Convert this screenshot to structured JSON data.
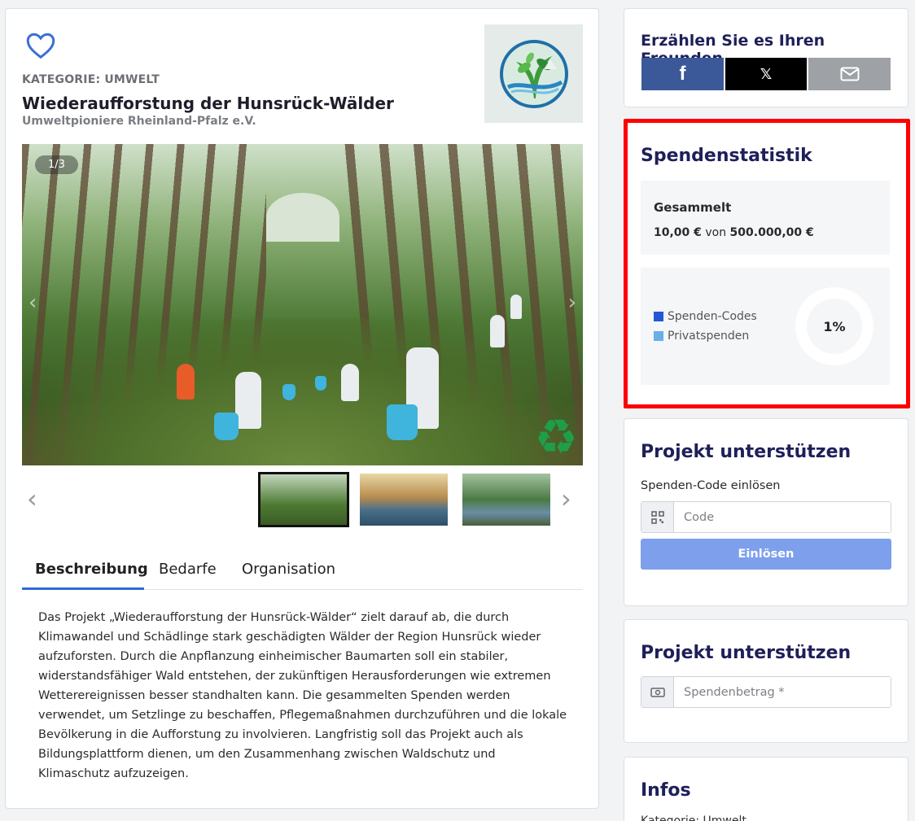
{
  "project": {
    "category": "KATEGORIE: UMWELT",
    "title": "Wiederaufforstung der Hunsrück-Wälder",
    "organization": "Umweltpioniere Rheinland-Pfalz e.V.",
    "image_counter": "1/3",
    "favorite_icon": "heart-outline-icon",
    "tabs": [
      "Beschreibung",
      "Bedarfe",
      "Organisation"
    ],
    "active_tab": "Beschreibung",
    "description": "Das Projekt „Wiederaufforstung der Hunsrück-Wälder“ zielt darauf ab, die durch Klimawandel und Schädlinge stark geschädigten Wälder der Region Hunsrück wieder aufzuforsten. Durch die Anpflanzung einheimischer Baumarten soll ein stabiler, widerstandsfähiger Wald entstehen, der zukünftigen Herausforderungen wie extremen Wetterereignissen besser standhalten kann. Die gesammelten Spenden werden verwendet, um Setzlinge zu beschaffen, Pflegemaßnahmen durchzuführen und die lokale Bevölkerung in die Aufforstung zu involvieren. Langfristig soll das Projekt auch als Bildungsplattform dienen, um den Zusammenhang zwischen Waldschutz und Klimaschutz aufzuzeigen."
  },
  "share": {
    "title": "Erzählen Sie es Ihren Freunden",
    "facebook_glyph": "f",
    "x_glyph": "𝕏",
    "colors": {
      "facebook": "#3b5998",
      "x": "#000000",
      "email": "#9ea1a5"
    }
  },
  "stats": {
    "title": "Spendenstatistik",
    "collected_label": "Gesammelt",
    "collected_amount": "10,00 €",
    "collected_von": "von",
    "goal_amount": "500.000,00 €",
    "percent_label": "1%",
    "percent_value": 2e-05,
    "legend": [
      {
        "name": "Spenden-Codes",
        "color": "#2458d4"
      },
      {
        "name": "Privatspenden",
        "color": "#6aaee8"
      }
    ]
  },
  "redeem": {
    "title": "Projekt unterstützen",
    "field_label": "Spenden-Code einlösen",
    "placeholder": "Code",
    "button": "Einlösen"
  },
  "donate": {
    "title": "Projekt unterstützen",
    "placeholder": "Spendenbetrag *"
  },
  "infos": {
    "title": "Infos",
    "line": "Kategorie: Umwelt"
  }
}
